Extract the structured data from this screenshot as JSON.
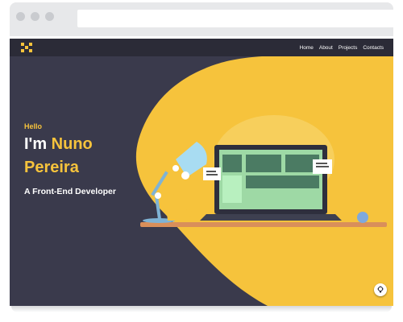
{
  "nav": {
    "items": [
      {
        "label": "Home"
      },
      {
        "label": "About"
      },
      {
        "label": "Projects"
      },
      {
        "label": "Contacts"
      }
    ]
  },
  "hero": {
    "greeting": "Hello",
    "intro": "I'm",
    "first_name": "Nuno",
    "last_name": "Pereira",
    "subtitle": "A Front-End Developer"
  },
  "colors": {
    "accent": "#f6c33c",
    "background": "#3a3a4c",
    "nav": "#2b2b37"
  },
  "icons": {
    "theme_toggle": "lightbulb-icon",
    "logo": "logo-icon"
  }
}
